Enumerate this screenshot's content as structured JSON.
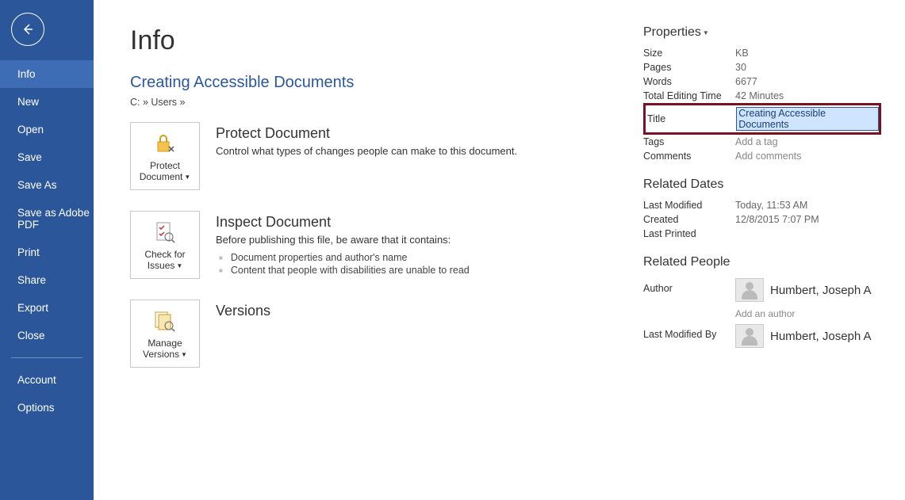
{
  "sidebar": {
    "items": [
      {
        "label": "Info",
        "selected": true
      },
      {
        "label": "New",
        "selected": false
      },
      {
        "label": "Open",
        "selected": false
      },
      {
        "label": "Save",
        "selected": false
      },
      {
        "label": "Save As",
        "selected": false
      },
      {
        "label": "Save as Adobe PDF",
        "selected": false
      },
      {
        "label": "Print",
        "selected": false
      },
      {
        "label": "Share",
        "selected": false
      },
      {
        "label": "Export",
        "selected": false
      },
      {
        "label": "Close",
        "selected": false
      }
    ],
    "footer": [
      {
        "label": "Account"
      },
      {
        "label": "Options"
      }
    ]
  },
  "page": {
    "title": "Info",
    "doc_title": "Creating Accessible Documents",
    "doc_path": "C: » Users »"
  },
  "protect": {
    "btn": "Protect Document",
    "heading": "Protect Document",
    "desc": "Control what types of changes people can make to this document."
  },
  "inspect": {
    "btn": "Check for Issues",
    "heading": "Inspect Document",
    "desc": "Before publishing this file, be aware that it contains:",
    "bullets": [
      "Document properties and author's name",
      "Content that people with disabilities are unable to read"
    ]
  },
  "versions": {
    "btn": "Manage Versions",
    "heading": "Versions"
  },
  "props": {
    "heading": "Properties",
    "rows": {
      "size": {
        "label": "Size",
        "value": "KB"
      },
      "pages": {
        "label": "Pages",
        "value": "30"
      },
      "words": {
        "label": "Words",
        "value": "6677"
      },
      "edit_time": {
        "label": "Total Editing Time",
        "value": "42 Minutes"
      },
      "title": {
        "label": "Title",
        "value": "Creating Accessible Documents"
      },
      "tags": {
        "label": "Tags",
        "value": "Add a tag"
      },
      "comments": {
        "label": "Comments",
        "value": "Add comments"
      }
    }
  },
  "dates": {
    "heading": "Related Dates",
    "last_modified": {
      "label": "Last Modified",
      "value": "Today, 11:53 AM"
    },
    "created": {
      "label": "Created",
      "value": "12/8/2015 7:07 PM"
    },
    "last_printed": {
      "label": "Last Printed",
      "value": ""
    }
  },
  "people": {
    "heading": "Related People",
    "author_label": "Author",
    "author_name": "Humbert, Joseph A",
    "add_author": "Add an author",
    "last_modified_by_label": "Last Modified By",
    "last_modified_by_name": "Humbert, Joseph A"
  }
}
